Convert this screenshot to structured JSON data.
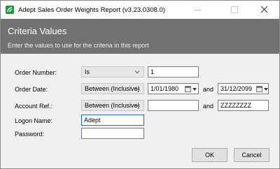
{
  "window": {
    "title": "Adept Sales Order Weights Report (v3.23.0308.0)",
    "icon": "app-logo-icon",
    "accent": "#1e9a3c"
  },
  "header": {
    "title": "Criteria Values",
    "subtitle": "Enter the values to use for the criteria in this report"
  },
  "form": {
    "order_number": {
      "label": "Order Number:",
      "operator": "Is",
      "value": "1"
    },
    "order_date": {
      "label": "Order Date:",
      "operator": "Between (Inclusive)",
      "from": "1/01/1980",
      "and_label": "and",
      "to": "31/12/2099"
    },
    "account_ref": {
      "label": "Account Ref.:",
      "operator": "Between (Inclusive)",
      "from": "",
      "and_label": "and",
      "to": "ZZZZZZZZ"
    },
    "logon_name": {
      "label": "Logon Name:",
      "value": "Adept"
    },
    "password": {
      "label": "Password:",
      "value": ""
    }
  },
  "buttons": {
    "ok": "OK",
    "cancel": "Cancel"
  }
}
